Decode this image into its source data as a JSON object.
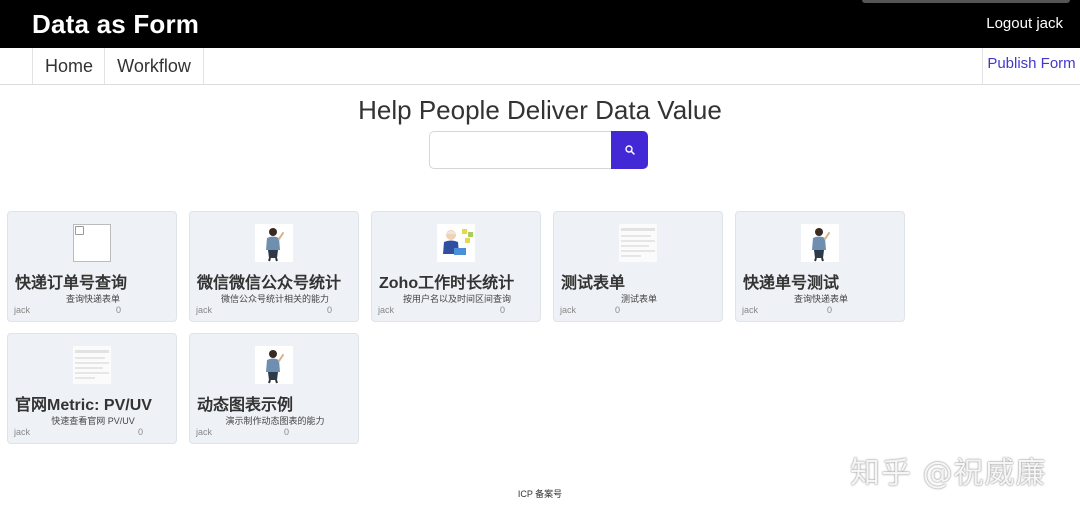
{
  "header": {
    "brand": "Data as Form",
    "logout_label": "Logout",
    "username": "jack"
  },
  "nav": {
    "home": "Home",
    "workflow": "Workflow",
    "publish": "Publish Form"
  },
  "hero": {
    "title": "Help People Deliver Data Value"
  },
  "search": {
    "value": "",
    "placeholder": ""
  },
  "cards": [
    {
      "title": "快递订单号查询",
      "desc": "查询快递表单",
      "author": "jack",
      "count": "0",
      "thumbnail": "broken-image-icon"
    },
    {
      "title": "微信微信公众号统计",
      "desc": "微信公众号统计相关的能力",
      "author": "jack",
      "count": "0",
      "thumbnail": "person-illustration"
    },
    {
      "title": "Zoho工作时长统计",
      "desc": "按用户名以及时间区间查询",
      "author": "jack",
      "count": "0",
      "thumbnail": "office-worker-illustration"
    },
    {
      "title": "测试表单",
      "desc": "测试表单",
      "author": "jack",
      "count": "0",
      "thumbnail": "form-screenshot"
    },
    {
      "title": "快递单号测试",
      "desc": "查询快递表单",
      "author": "jack",
      "count": "0",
      "thumbnail": "person-illustration"
    },
    {
      "title": "官网Metric: PV/UV",
      "desc": "快速查看官网 PV/UV",
      "author": "jack",
      "count": "0",
      "thumbnail": "form-screenshot"
    },
    {
      "title": "动态图表示例",
      "desc": "演示制作动态图表的能力",
      "author": "jack",
      "count": "0",
      "thumbnail": "person-illustration"
    }
  ],
  "footer": {
    "icp": "ICP 备案号"
  },
  "watermark": {
    "text": "知乎 @祝威廉"
  },
  "colors": {
    "topbar": "#000000",
    "accent": "#4328d6",
    "link": "#4338ca",
    "card_bg": "#eef1f6"
  }
}
